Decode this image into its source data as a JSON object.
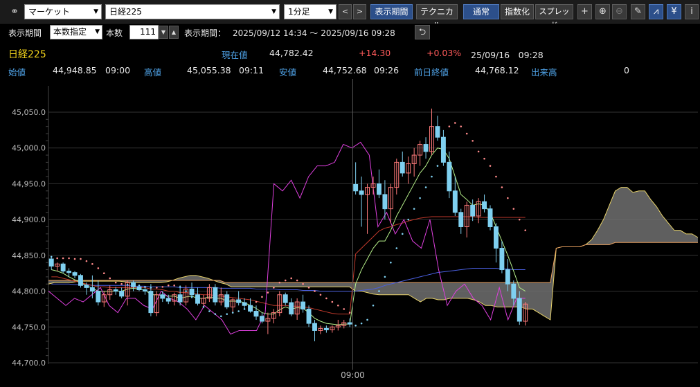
{
  "toolbar": {
    "link_icon": "link-icon",
    "market_select": "マーケット",
    "symbol_select": "日経225",
    "interval_select": "1分足",
    "prev_label": "<",
    "next_label": ">",
    "display_period_btn": "表示期間",
    "technical_btn": "テクニカル",
    "normal_btn": "通常",
    "index_btn": "指数化",
    "spread_btn": "スプレッド",
    "icons": [
      "crosshair-icon",
      "zoom-in-icon",
      "zoom-out-icon",
      "pencil-icon",
      "chart-tool-icon",
      "yen-icon",
      "info-icon"
    ],
    "icon_glyphs": {
      "crosshair": "+",
      "zoom_in": "⊕",
      "zoom_out": "⊖",
      "pencil": "✎",
      "chart_tool": "⩘",
      "yen": "¥",
      "info": "i"
    }
  },
  "period_bar": {
    "label": "表示期間",
    "mode_select": "本数指定",
    "count_label": "本数",
    "count_value": "111",
    "range_label": "表示期間：",
    "range_value": "2025/09/12 14:34 ～ 2025/09/16 09:28",
    "return_icon": "return-icon"
  },
  "quote": {
    "name": "日経225",
    "current_label": "現在値",
    "current_value": "44,782.42",
    "change": "+14.30",
    "change_pct": "+0.03%",
    "datetime": "25/09/16　09:28",
    "open_label": "始値",
    "open_value": "44,948.85",
    "open_time": "09:00",
    "high_label": "高値",
    "high_value": "45,055.38",
    "high_time": "09:11",
    "low_label": "安値",
    "low_value": "44,752.68",
    "low_time": "09:26",
    "prev_close_label": "前日終値",
    "prev_close_value": "44,768.12",
    "volume_label": "出来高",
    "volume_value": "0"
  },
  "chart_data": {
    "type": "line",
    "ylim": [
      44700,
      45050
    ],
    "yticks": [
      44700,
      44750,
      44800,
      44850,
      44900,
      44950,
      45000,
      45050
    ],
    "ytick_labels": [
      "44,700.0",
      "44,750.0",
      "44,800.0",
      "44,850.0",
      "44,900.0",
      "44,950.0",
      "45,000.0",
      "45,050.0"
    ],
    "xlabel_tick": "09:00",
    "x_session_break_index": 52,
    "num_bars": 111,
    "colors": {
      "up": "#ff7a7a",
      "down": "#7fd0f0",
      "grid": "#333333",
      "cloud": "#707070"
    },
    "candles_ohlc": [
      [
        44845,
        44848,
        44830,
        44835
      ],
      [
        44835,
        44840,
        44828,
        44838
      ],
      [
        44838,
        44840,
        44825,
        44828
      ],
      [
        44828,
        44832,
        44820,
        44826
      ],
      [
        44826,
        44828,
        44818,
        44822
      ],
      [
        44822,
        44824,
        44805,
        44808
      ],
      [
        44808,
        44812,
        44795,
        44805
      ],
      [
        44805,
        44822,
        44790,
        44800
      ],
      [
        44800,
        44815,
        44780,
        44785
      ],
      [
        44785,
        44800,
        44778,
        44795
      ],
      [
        44795,
        44808,
        44788,
        44802
      ],
      [
        44802,
        44806,
        44795,
        44800
      ],
      [
        44800,
        44805,
        44790,
        44793
      ],
      [
        44793,
        44815,
        44780,
        44812
      ],
      [
        44812,
        44815,
        44800,
        44806
      ],
      [
        44806,
        44808,
        44800,
        44802
      ],
      [
        44802,
        44806,
        44795,
        44800
      ],
      [
        44800,
        44810,
        44765,
        44770
      ],
      [
        44770,
        44800,
        44765,
        44795
      ],
      [
        44795,
        44800,
        44785,
        44790
      ],
      [
        44790,
        44795,
        44782,
        44786
      ],
      [
        44786,
        44798,
        44780,
        44795
      ],
      [
        44795,
        44808,
        44780,
        44785
      ],
      [
        44785,
        44808,
        44780,
        44803
      ],
      [
        44803,
        44812,
        44790,
        44795
      ],
      [
        44795,
        44805,
        44780,
        44783
      ],
      [
        44783,
        44795,
        44778,
        44790
      ],
      [
        44790,
        44810,
        44785,
        44805
      ],
      [
        44805,
        44810,
        44780,
        44785
      ],
      [
        44785,
        44805,
        44780,
        44795
      ],
      [
        44795,
        44800,
        44775,
        44778
      ],
      [
        44778,
        44790,
        44770,
        44788
      ],
      [
        44788,
        44800,
        44780,
        44784
      ],
      [
        44784,
        44790,
        44775,
        44780
      ],
      [
        44780,
        44790,
        44770,
        44772
      ],
      [
        44772,
        44780,
        44760,
        44765
      ],
      [
        44765,
        44770,
        44755,
        44758
      ],
      [
        44758,
        44770,
        44740,
        44762
      ],
      [
        44762,
        44775,
        44755,
        44770
      ],
      [
        44770,
        44800,
        44765,
        44795
      ],
      [
        44795,
        44798,
        44780,
        44784
      ],
      [
        44784,
        44790,
        44765,
        44768
      ],
      [
        44768,
        44790,
        44760,
        44785
      ],
      [
        44785,
        44795,
        44770,
        44775
      ],
      [
        44775,
        44780,
        44750,
        44755
      ],
      [
        44755,
        44760,
        44730,
        44745
      ],
      [
        44745,
        44752,
        44740,
        44748
      ],
      [
        44748,
        44752,
        44742,
        44746
      ],
      [
        44746,
        44752,
        44742,
        44750
      ],
      [
        44750,
        44760,
        44745,
        44752
      ],
      [
        44752,
        44760,
        44748,
        44756
      ],
      [
        44756,
        44762,
        44750,
        44754
      ],
      [
        44949,
        44980,
        44935,
        44940
      ],
      [
        44940,
        44960,
        44890,
        44935
      ],
      [
        44935,
        44950,
        44880,
        44945
      ],
      [
        44945,
        44960,
        44935,
        44950
      ],
      [
        44950,
        44970,
        44930,
        44935
      ],
      [
        44935,
        44955,
        44900,
        44915
      ],
      [
        44915,
        44950,
        44895,
        44945
      ],
      [
        44945,
        44985,
        44935,
        44980
      ],
      [
        44980,
        44995,
        44960,
        44965
      ],
      [
        44965,
        44988,
        44950,
        44978
      ],
      [
        44978,
        45000,
        44960,
        44990
      ],
      [
        44990,
        45010,
        44975,
        45005
      ],
      [
        45005,
        45015,
        44985,
        44995
      ],
      [
        44995,
        45055,
        44990,
        45030
      ],
      [
        45030,
        45045,
        45010,
        45015
      ],
      [
        45015,
        45025,
        44975,
        44980
      ],
      [
        44980,
        44995,
        44930,
        44940
      ],
      [
        44940,
        44960,
        44905,
        44910
      ],
      [
        44910,
        44915,
        44880,
        44890
      ],
      [
        44890,
        44925,
        44875,
        44920
      ],
      [
        44920,
        44928,
        44898,
        44905
      ],
      [
        44905,
        44930,
        44895,
        44925
      ],
      [
        44925,
        44935,
        44910,
        44915
      ],
      [
        44915,
        44920,
        44885,
        44890
      ],
      [
        44890,
        44895,
        44840,
        44860
      ],
      [
        44860,
        44870,
        44825,
        44830
      ],
      [
        44830,
        44845,
        44800,
        44810
      ],
      [
        44810,
        44815,
        44780,
        44790
      ],
      [
        44790,
        44800,
        44753,
        44758
      ],
      [
        44758,
        44785,
        44752,
        44782
      ]
    ],
    "ichimoku_span_a": [
      44810,
      44812,
      44812,
      44812,
      44812,
      44814,
      44814,
      44814,
      44814,
      44814,
      44814,
      44814,
      44814,
      44813,
      44812,
      44812,
      44812,
      44812,
      44812,
      44812,
      44813,
      44815,
      44818,
      44820,
      44822,
      44822,
      44820,
      44818,
      44815,
      44812,
      44810,
      44806,
      44806,
      44806,
      44806,
      44806,
      44806,
      44806,
      44806,
      44806,
      44806,
      44806,
      44806,
      44806,
      44806,
      44806,
      44806,
      44806,
      44806,
      44806,
      44806,
      44806,
      44800,
      44800,
      44798,
      44796,
      44795,
      44795,
      44795,
      44795,
      44795,
      44795,
      44790,
      44785,
      44790,
      44790,
      44788,
      44788,
      44790,
      44790,
      44790,
      44790,
      44788,
      44785,
      44780,
      44780,
      44778,
      44778,
      44778,
      44778,
      44778,
      44775,
      44775,
      44770,
      44765,
      44760,
      44860,
      44862,
      44862,
      44862,
      44862,
      44865,
      44872,
      44885,
      44900,
      44920,
      44940,
      44945,
      44945,
      44938,
      44940,
      44940,
      44928,
      44918,
      44905,
      44895,
      44885,
      44885,
      44880,
      44880,
      44875
    ],
    "ichimoku_span_b": [
      44815,
      44815,
      44815,
      44815,
      44815,
      44815,
      44815,
      44815,
      44815,
      44815,
      44815,
      44815,
      44815,
      44815,
      44815,
      44815,
      44815,
      44815,
      44815,
      44815,
      44815,
      44815,
      44815,
      44815,
      44815,
      44815,
      44815,
      44815,
      44815,
      44815,
      44812,
      44812,
      44812,
      44812,
      44812,
      44812,
      44812,
      44812,
      44812,
      44812,
      44812,
      44812,
      44812,
      44812,
      44812,
      44812,
      44812,
      44812,
      44812,
      44812,
      44812,
      44812,
      44812,
      44812,
      44812,
      44812,
      44812,
      44812,
      44812,
      44812,
      44812,
      44812,
      44812,
      44812,
      44812,
      44812,
      44812,
      44812,
      44812,
      44812,
      44812,
      44812,
      44812,
      44812,
      44812,
      44812,
      44812,
      44812,
      44812,
      44812,
      44812,
      44812,
      44812,
      44812,
      44812,
      44812,
      44860,
      44862,
      44862,
      44862,
      44862,
      44865,
      44865,
      44865,
      44865,
      44865,
      44868,
      44868,
      44868,
      44868,
      44868,
      44868,
      44868,
      44868,
      44868,
      44868,
      44868,
      44868,
      44868,
      44868,
      44868
    ],
    "parabolic_sar": [
      44848,
      44846,
      44846,
      44846,
      44845,
      44845,
      44842,
      44838,
      44832,
      44825,
      44818,
      44812,
      44810,
      44809,
      44808,
      44808,
      44806,
      44805,
      44805,
      44806,
      44808,
      44808,
      44806,
      44800,
      44792,
      44785,
      44778,
      44772,
      44768,
      44765,
      44768,
      44770,
      44772,
      44775,
      44778,
      44785,
      44792,
      44798,
      44805,
      44812,
      44815,
      44818,
      44815,
      44810,
      44805,
      44800,
      44795,
      44790,
      44785,
      44780,
      44775,
      44770,
      44752,
      44755,
      44760,
      44780,
      44800,
      44820,
      44840,
      44860,
      44880,
      44900,
      44915,
      44930,
      44945,
      44960,
      44975,
      45010,
      45030,
      45035,
      45030,
      45020,
      45010,
      44995,
      44985,
      44975,
      44960,
      44945,
      44930,
      44915,
      44900,
      44885
    ],
    "rsi_line": [
      44800,
      44790,
      44780,
      44790,
      44785,
      44795,
      44805,
      44780,
      44770,
      44790,
      44790,
      44780,
      44775,
      44800,
      44790,
      44785,
      44775,
      44760,
      44780,
      44770,
      44760,
      44740,
      44745,
      44745,
      44745,
      44770,
      44950,
      44940,
      44955,
      44930,
      44960,
      44975,
      44975,
      44980,
      45005,
      45000,
      45008,
      44990,
      44890,
      44910,
      44880,
      44900,
      44870,
      44860,
      44900,
      44830,
      44780,
      44800,
      44810,
      44790,
      44780,
      44760,
      44805,
      44760,
      44790,
      44790
    ],
    "ema_short": [
      44830,
      44828,
      44825,
      44820,
      44816,
      44812,
      44808,
      44804,
      44800,
      44800,
      44800,
      44800,
      44800,
      44803,
      44804,
      44803,
      44802,
      44795,
      44795,
      44794,
      44793,
      44793,
      44790,
      44792,
      44793,
      44790,
      44790,
      44792,
      44790,
      44790,
      44786,
      44786,
      44786,
      44784,
      44780,
      44776,
      44770,
      44768,
      44768,
      44774,
      44778,
      44775,
      44777,
      44776,
      44770,
      44762,
      44758,
      44755,
      44754,
      44753,
      44754,
      44754,
      44810,
      44830,
      44845,
      44860,
      44870,
      44870,
      44885,
      44905,
      44920,
      44935,
      44950,
      44965,
      44975,
      44990,
      45000,
      44998,
      44985,
      44960,
      44935,
      44928,
      44920,
      44922,
      44920,
      44910,
      44890,
      44870,
      44850,
      44828,
      44805,
      44800
    ],
    "ma_mid": [
      44820,
      44820,
      44818,
      44816,
      44814,
      44812,
      44810,
      44808,
      44806,
      44806,
      44805,
      44805,
      44805,
      44805,
      44805,
      44805,
      44805,
      44803,
      44803,
      44802,
      44800,
      44800,
      44798,
      44798,
      44797,
      44796,
      44795,
      44795,
      44794,
      44793,
      44792,
      44791,
      44790,
      44789,
      44788,
      44786,
      44784,
      44782,
      44780,
      44780,
      44780,
      44779,
      44779,
      44778,
      44777,
      44775,
      44773,
      44771,
      44769,
      44768,
      44768,
      44768,
      44852,
      44860,
      44868,
      44876,
      44884,
      44888,
      44890,
      44893,
      44895,
      44898,
      44900,
      44902,
      44903,
      44904,
      44904,
      44904,
      44904,
      44904,
      44904,
      44904,
      44904,
      44903,
      44903,
      44903,
      44903,
      44903,
      44903,
      44903,
      44903,
      44903
    ],
    "ma_long": [
      44810,
      44810,
      44810,
      44810,
      44809,
      44809,
      44809,
      44808,
      44808,
      44808,
      44808,
      44808,
      44808,
      44808,
      44807,
      44807,
      44807,
      44806,
      44806,
      44806,
      44806,
      44806,
      44805,
      44805,
      44805,
      44805,
      44805,
      44805,
      44805,
      44804,
      44804,
      44804,
      44804,
      44804,
      44804,
      44803,
      44803,
      44803,
      44803,
      44802,
      44802,
      44802,
      44802,
      44801,
      44801,
      44801,
      44800,
      44800,
      44800,
      44800,
      44800,
      44800,
      44800,
      44801,
      44802,
      44803,
      44805,
      44808,
      44810,
      44812,
      44814,
      44816,
      44818,
      44820,
      44822,
      44824,
      44826,
      44827,
      44828,
      44829,
      44830,
      44831,
      44832,
      44832,
      44832,
      44832,
      44832,
      44831,
      44831,
      44830,
      44830,
      44830
    ]
  }
}
